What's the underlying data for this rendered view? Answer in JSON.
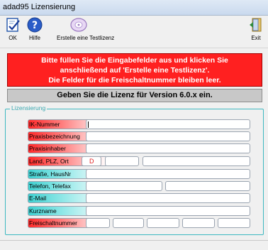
{
  "window": {
    "title": "adad95 Lizensierung"
  },
  "toolbar": {
    "ok_label": "OK",
    "help_label": "Hilfe",
    "trial_label": "Erstelle eine Testlizenz",
    "exit_label": "Exit"
  },
  "message": {
    "line1": "Bitte füllen Sie die Eingabefelder aus und klicken Sie",
    "line2": "anschließend auf 'Erstelle eine Testlizenz'.",
    "line3": "Die Felder für die Freischaltnummer bleiben leer."
  },
  "header": {
    "text": "Geben Sie die Lizenz für Version 6.0.x ein."
  },
  "group": {
    "legend": "Lizensierung"
  },
  "fields": {
    "ik": "IK-Nummer",
    "praxis": "Praxisbezeichnung",
    "inhaber": "Praxisinhaber",
    "land": "Land, PLZ, Ort",
    "land_value": "D",
    "strasse": "Straße, HausNr",
    "telefon": "Telefon, Telefax",
    "email": "E-Mail",
    "kurzname": "Kurzname",
    "freischalt": "Freischaltnummer"
  },
  "colors": {
    "required": "#ff2a2a",
    "optional": "#3fd0d0",
    "banner": "#ff2020"
  },
  "icons": {
    "ok": "checkmark-document-icon",
    "help": "question-mark-icon",
    "trial": "disc-icon",
    "exit": "exit-door-icon"
  }
}
